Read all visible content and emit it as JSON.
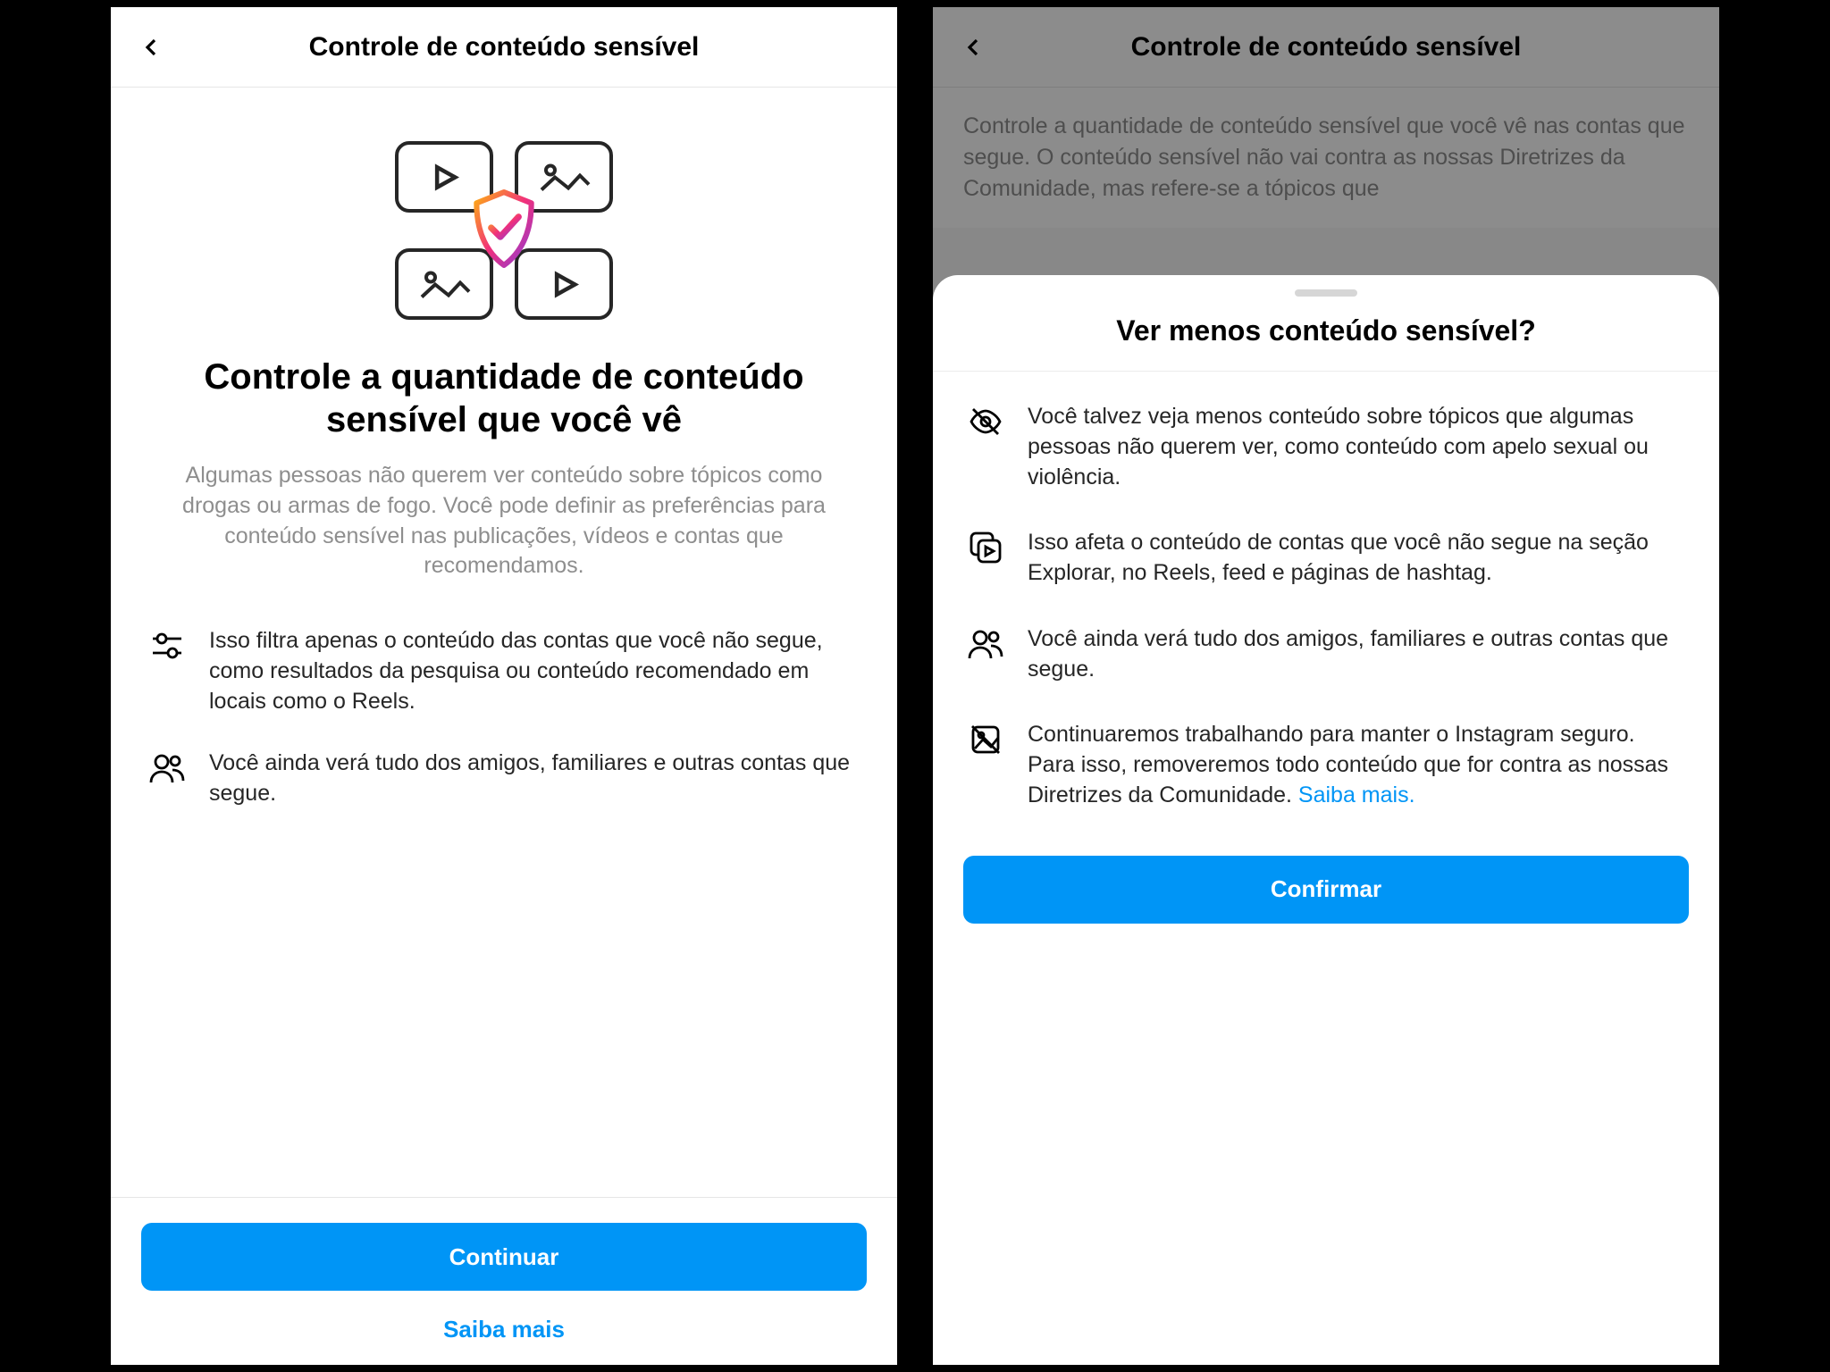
{
  "left": {
    "header_title": "Controle de conteúdo sensível",
    "hero_title": "Controle a quantidade de conteúdo sensível que você vê",
    "hero_sub": "Algumas pessoas não querem ver conteúdo sobre tópicos como drogas ou armas de fogo. Você pode definir as preferências para conteúdo sensível nas publicações, vídeos e contas que recomendamos.",
    "bullets": [
      "Isso filtra apenas o conteúdo das contas que você não segue, como resultados da pesquisa ou conteúdo recomendado em locais como o Reels.",
      "Você ainda verá tudo dos amigos, familiares e outras contas que segue."
    ],
    "primary_btn": "Continuar",
    "secondary_link": "Saiba mais"
  },
  "right": {
    "header_title": "Controle de conteúdo sensível",
    "bg_body": "Controle a quantidade de conteúdo sensível que você vê nas contas que segue. O conteúdo sensível não vai contra as nossas Diretrizes da Comunidade, mas refere-se a tópicos que",
    "sheet_title": "Ver menos conteúdo sensível?",
    "bullets": [
      "Você talvez veja menos conteúdo sobre tópicos que algumas pessoas não querem ver, como conteúdo com apelo sexual ou violência.",
      "Isso afeta o conteúdo de contas que você não segue na seção Explorar, no Reels, feed e páginas de hashtag.",
      "Você ainda verá tudo dos amigos, familiares e outras contas que segue.",
      "Continuaremos trabalhando para manter o Instagram seguro. Para isso, removeremos todo conteúdo que for contra as nossas Diretrizes da Comunidade. "
    ],
    "learn_more": "Saiba mais.",
    "confirm_btn": "Confirmar"
  },
  "colors": {
    "accent": "#0095f6"
  }
}
